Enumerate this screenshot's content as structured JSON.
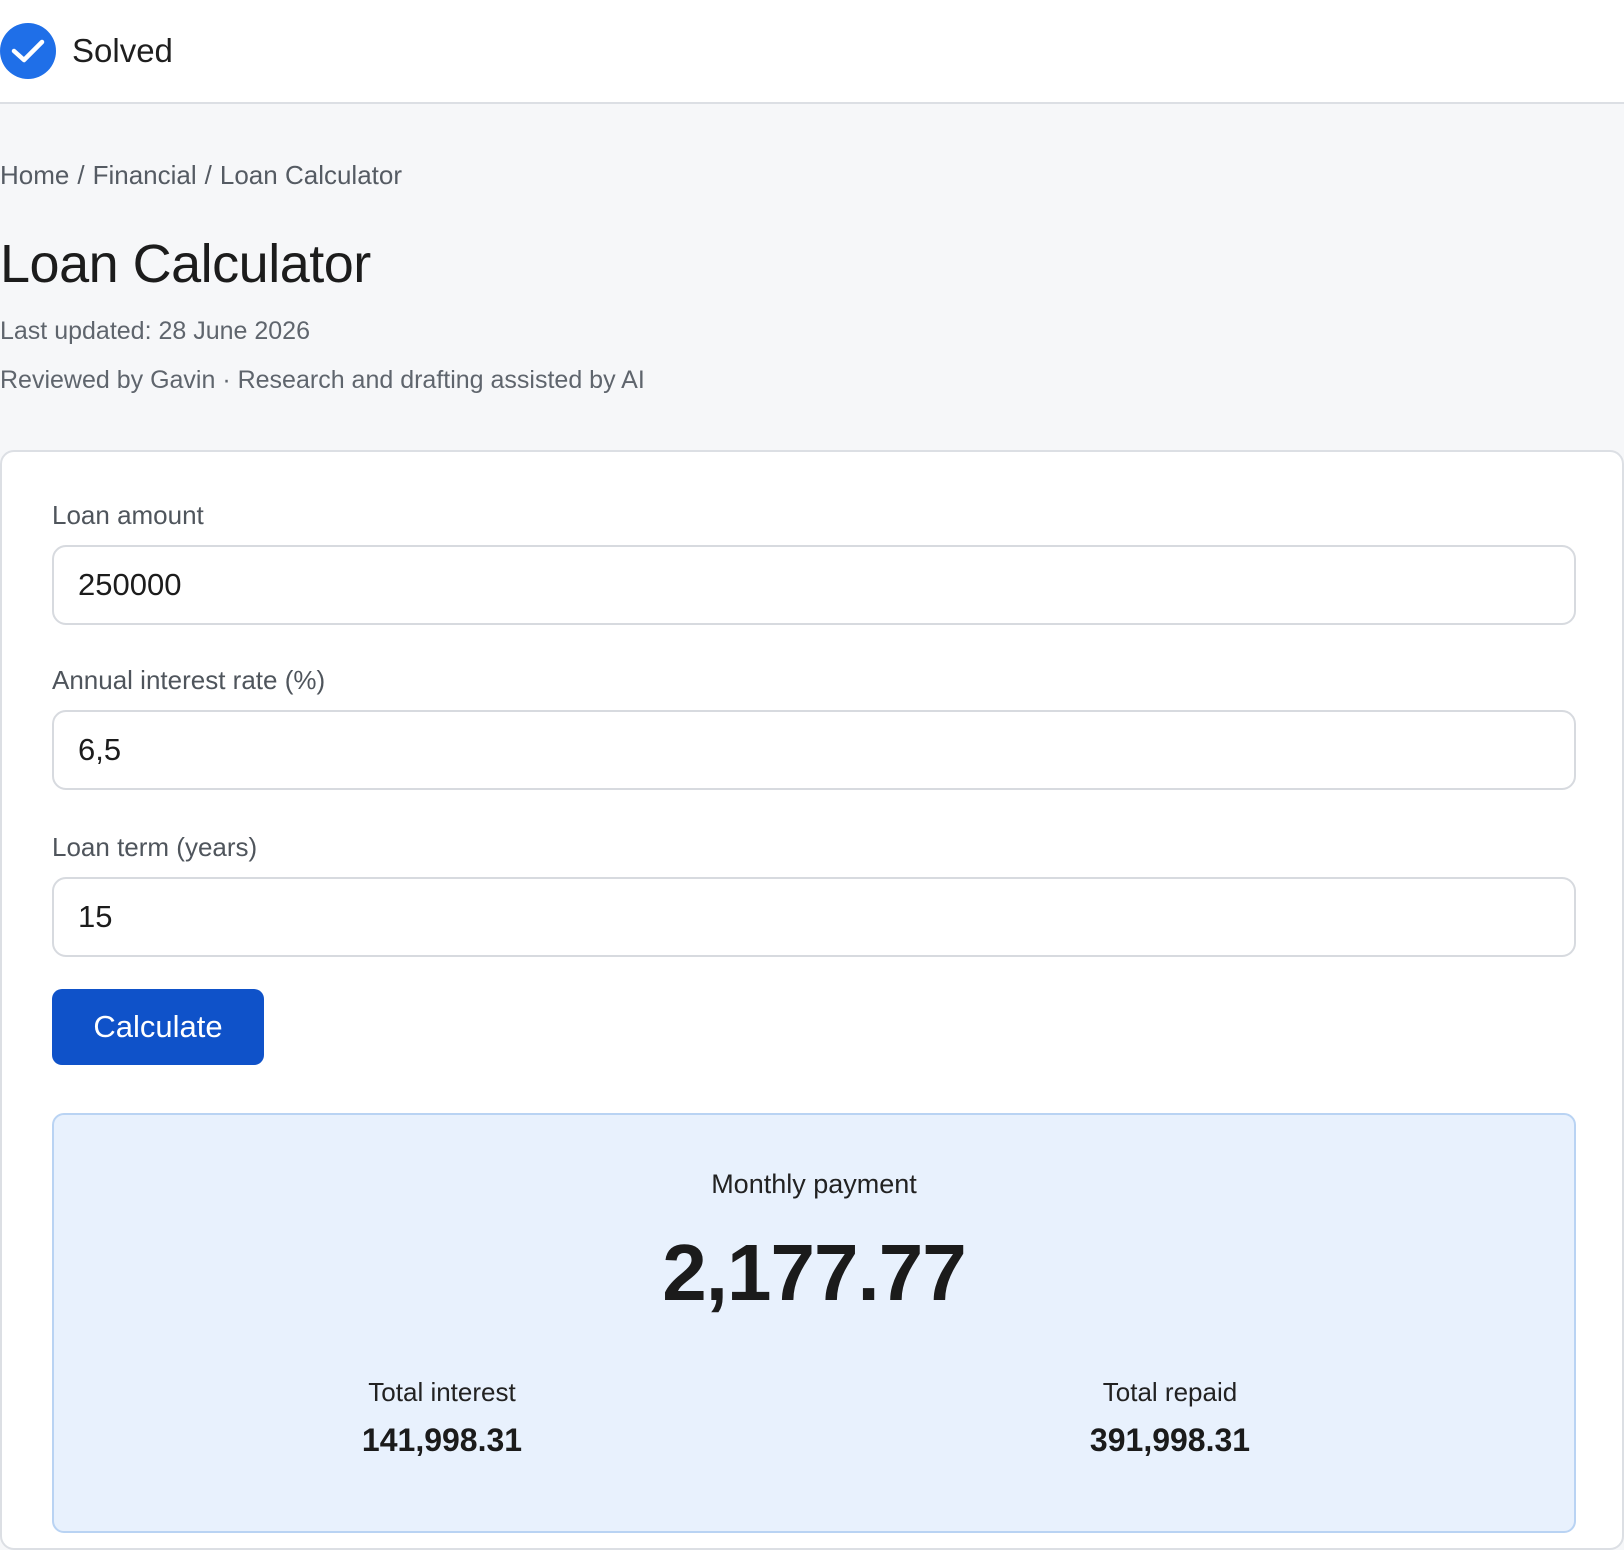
{
  "status": {
    "label": "Solved",
    "icon": "check-circle-icon",
    "color": "#1f6fe8"
  },
  "breadcrumb": [
    "Home",
    "Financial",
    "Loan Calculator"
  ],
  "breadcrumb_separator": "/",
  "page": {
    "title": "Loan Calculator",
    "last_updated": "Last updated: 28 June 2026",
    "credits": "Reviewed by Gavin · Research and drafting assisted by AI"
  },
  "form": {
    "loan_amount": {
      "label": "Loan amount",
      "value": "250000"
    },
    "interest_rate": {
      "label": "Annual interest rate (%)",
      "value": "6,5"
    },
    "loan_term": {
      "label": "Loan term (years)",
      "value": "15"
    },
    "submit_label": "Calculate",
    "button_color": "#0f52c9"
  },
  "result": {
    "monthly_label": "Monthly payment",
    "monthly_value": "2,177.77",
    "total_interest_label": "Total interest",
    "total_interest_value": "141,998.31",
    "total_repaid_label": "Total repaid",
    "total_repaid_value": "391,998.31",
    "background_color": "#e8f1fd"
  }
}
